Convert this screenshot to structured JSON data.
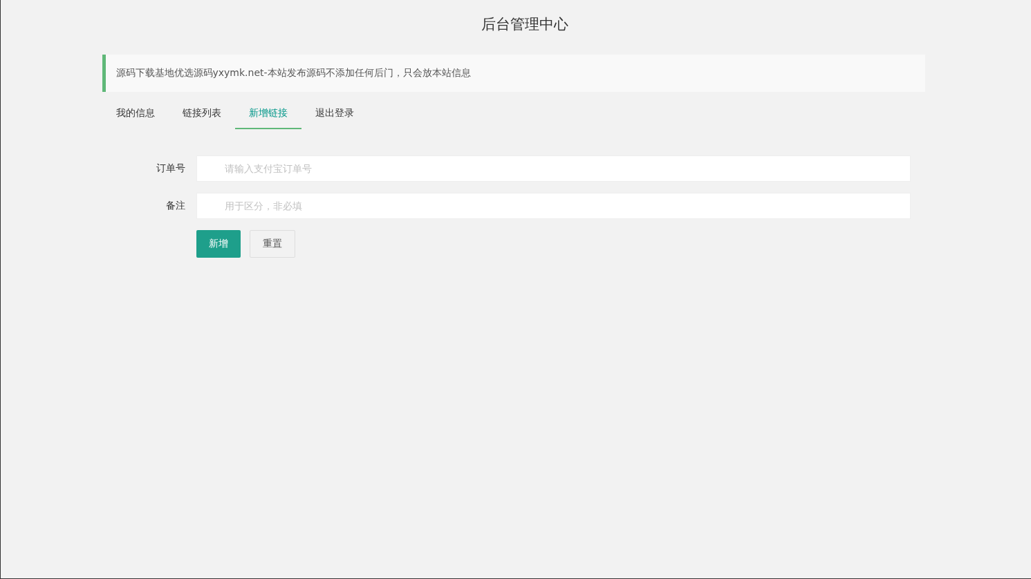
{
  "page_title": "后台管理中心",
  "notice": "源码下载基地优选源码yxymk.net-本站发布源码不添加任何后门，只会放本站信息",
  "tabs": [
    {
      "label": "我的信息",
      "selected": false
    },
    {
      "label": "链接列表",
      "selected": false
    },
    {
      "label": "新增链接",
      "selected": true
    },
    {
      "label": "退出登录",
      "selected": false
    }
  ],
  "form": {
    "fields": [
      {
        "label": "订单号",
        "placeholder": "请输入支付宝订单号"
      },
      {
        "label": "备注",
        "placeholder": "用于区分，非必填"
      }
    ],
    "buttons": [
      {
        "label": "新增",
        "kind": "primary"
      },
      {
        "label": "重置",
        "kind": "default"
      }
    ]
  }
}
